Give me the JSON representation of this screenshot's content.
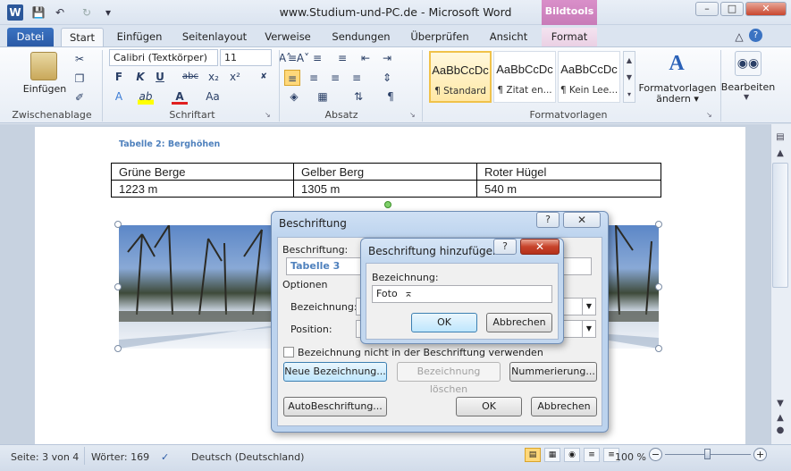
{
  "window": {
    "title": "www.Studium-und-PC.de - Microsoft Word",
    "contextual_tab_group": "Bildtools",
    "controls": [
      "–",
      "□",
      "✕"
    ]
  },
  "quick_access": {
    "word_icon": "W",
    "save": "💾",
    "undo": "↶",
    "redo": "↻"
  },
  "tabs": [
    "Datei",
    "Start",
    "Einfügen",
    "Seitenlayout",
    "Verweise",
    "Sendungen",
    "Überprüfen",
    "Ansicht",
    "Format"
  ],
  "ribbon": {
    "clipboard": {
      "paste_label": "Einfügen",
      "group": "Zwischenablage"
    },
    "font": {
      "name": "Calibri (Textkörper)",
      "size": "11",
      "group": "Schriftart",
      "buttons": [
        "F",
        "K",
        "U",
        "abc",
        "x₂",
        "x²",
        "A",
        "ab",
        "A",
        "Aa"
      ]
    },
    "paragraph": {
      "group": "Absatz",
      "pilcrow": "¶"
    },
    "styles": {
      "group": "Formatvorlagen",
      "items": [
        {
          "sample": "AaBbCcDc",
          "name": "¶ Standard"
        },
        {
          "sample": "AaBbCcDc",
          "name": "¶ Zitat en..."
        },
        {
          "sample": "AaBbCcDc",
          "name": "¶ Kein Lee..."
        }
      ],
      "change_label_1": "Formatvorlagen",
      "change_label_2": "ändern"
    },
    "edit": {
      "label": "Bearbeiten"
    }
  },
  "document": {
    "table_caption": "Tabelle 2: Berghöhen",
    "table": [
      [
        "Grüne Berge",
        "Gelber Berg",
        "Roter Hügel"
      ],
      [
        "1223  m",
        "1305  m",
        "540  m"
      ]
    ]
  },
  "dialog_caption": {
    "title": "Beschriftung",
    "help": "?",
    "close": "✕",
    "caption_label": "Beschriftung:",
    "caption_value": "Tabelle 3",
    "options_label": "Optionen",
    "name_label": "Bezeichnung:",
    "position_label": "Position:",
    "exclude_label": "Bezeichnung nicht in der Beschriftung verwenden",
    "btn_new": "Neue Bezeichnung...",
    "btn_delete": "Bezeichnung löschen",
    "btn_numbering": "Nummerierung...",
    "btn_auto": "AutoBeschriftung...",
    "btn_ok": "OK",
    "btn_cancel": "Abbrechen"
  },
  "dialog_add": {
    "title": "Beschriftung hinzufügen",
    "help": "?",
    "close": "✕",
    "name_label": "Bezeichnung:",
    "name_value": "Foto",
    "btn_ok": "OK",
    "btn_cancel": "Abbrechen"
  },
  "statusbar": {
    "page": "Seite: 3 von 4",
    "words": "Wörter: 169",
    "language": "Deutsch (Deutschland)",
    "zoom": "100 %",
    "zoom_minus": "−",
    "zoom_plus": "+"
  }
}
